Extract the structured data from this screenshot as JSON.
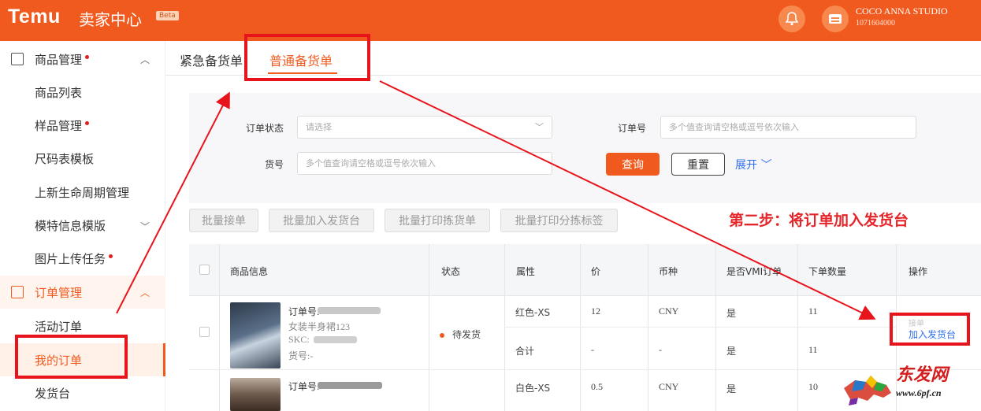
{
  "header": {
    "brand": "Temu",
    "title": "卖家中心",
    "beta": "Beta",
    "store_name": "COCO ANNA STUDIO",
    "store_id": "1071604000"
  },
  "sidebar": {
    "groups": [
      {
        "label": "商品管理",
        "has_dot": true
      },
      {
        "label": "订单管理",
        "has_dot": false
      }
    ],
    "items": [
      {
        "label": "商品列表"
      },
      {
        "label": "样品管理"
      },
      {
        "label": "尺码表模板"
      },
      {
        "label": "上新生命周期管理"
      },
      {
        "label": "模特信息模版"
      },
      {
        "label": "图片上传任务"
      },
      {
        "label": "活动订单"
      },
      {
        "label": "我的订单"
      },
      {
        "label": "发货台"
      }
    ]
  },
  "tabs": [
    {
      "label": "紧急备货单"
    },
    {
      "label": "普通备货单"
    }
  ],
  "filters": {
    "order_status_label": "订单状态",
    "order_status_placeholder": "请选择",
    "order_no_label": "订单号",
    "order_no_placeholder": "多个值查询请空格或逗号依次输入",
    "item_no_label": "货号",
    "item_no_placeholder": "多个值查询请空格或逗号依次输入",
    "search": "查询",
    "reset": "重置",
    "expand": "展开"
  },
  "batch_buttons": [
    "批量接单",
    "批量加入发货台",
    "批量打印拣货单",
    "批量打印分拣标签"
  ],
  "annotation": "第二步：将订单加入发货台",
  "table": {
    "headers": [
      "商品信息",
      "状态",
      "属性",
      "价",
      "币种",
      "是否VMI订单",
      "下单数量",
      "操作"
    ],
    "rows": [
      {
        "order_no": "订单号:",
        "product_name": "女装半身裙123",
        "skc": "SKC:",
        "item_no": "货号:-",
        "status": "待发货",
        "sub": [
          {
            "attr": "红色-XS",
            "price": "12",
            "currency": "CNY",
            "vmi": "是",
            "qty": "11"
          },
          {
            "attr": "合计",
            "price": "-",
            "currency": "-",
            "vmi": "是",
            "qty": "11"
          }
        ],
        "op_link": "加入发货台"
      },
      {
        "order_no": "订单号:",
        "sub": [
          {
            "attr": "白色-XS",
            "price": "0.5",
            "currency": "CNY",
            "vmi": "是",
            "qty": "10"
          }
        ]
      }
    ]
  },
  "watermark": {
    "text": "东发网",
    "url": "www.6pf.cn"
  },
  "colors": {
    "brand": "#f15a1e",
    "link": "#2f6fed",
    "annotation": "#e8141b"
  }
}
